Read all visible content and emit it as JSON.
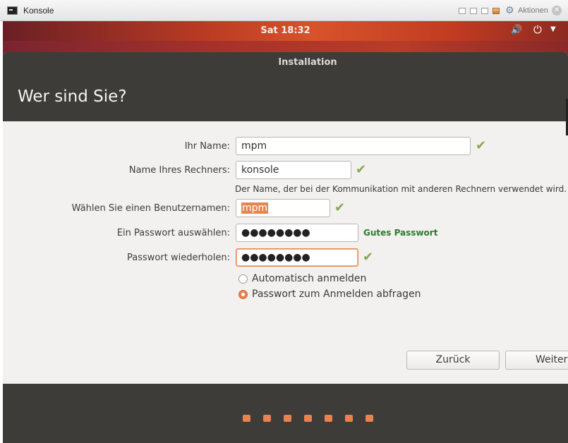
{
  "host": {
    "title": "Konsole",
    "actions_label": "Aktionen"
  },
  "panel": {
    "clock": "Sat 18:32"
  },
  "installer": {
    "window_title": "Installation",
    "page_title": "Wer sind Sie?",
    "form": {
      "name_label": "Ihr Name:",
      "name_value": "mpm",
      "computer_label": "Name Ihres Rechners:",
      "computer_value": "konsole",
      "computer_hint": "Der Name, der bei der Kommunikation mit anderen Rechnern verwendet wird.",
      "username_label": "Wählen Sie einen Benutzernamen:",
      "username_value": "mpm",
      "password_label": "Ein Passwort auswählen:",
      "password_value": "●●●●●●●●",
      "password_strength": "Gutes Passwort",
      "confirm_label": "Passwort wiederholen:",
      "confirm_value": "●●●●●●●●",
      "login_options": [
        {
          "label": "Automatisch anmelden",
          "selected": false
        },
        {
          "label": "Passwort zum Anmelden abfragen",
          "selected": true
        }
      ]
    },
    "buttons": {
      "back": "Zurück",
      "next": "Weiter"
    },
    "progress": {
      "steps": 7,
      "color": "#e8824f"
    }
  },
  "colors": {
    "accent": "#e5864f",
    "header_bg": "#3d3c38",
    "check": "#87a752",
    "strength": "#2b7c2b"
  }
}
